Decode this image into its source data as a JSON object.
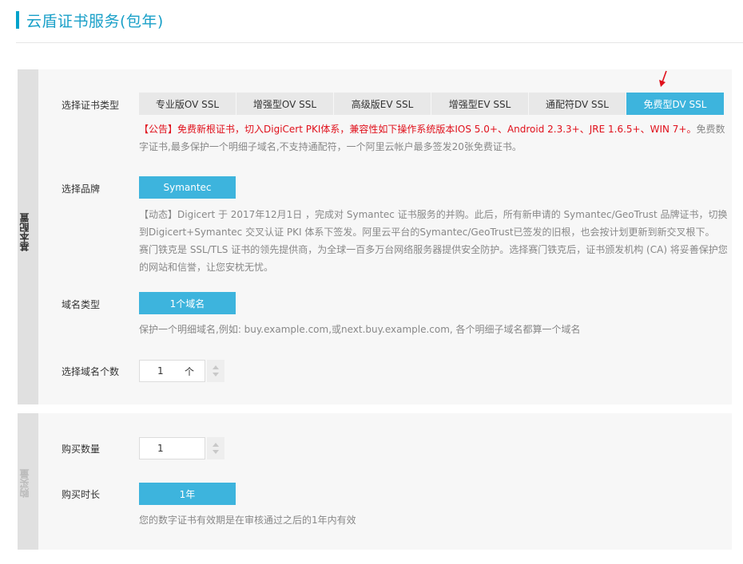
{
  "header": {
    "title": "云盾证书服务(包年)"
  },
  "colors": {
    "accent": "#3db4dd",
    "title": "#1aa0c8",
    "notice_red": "#e0101b",
    "arrow": "#e0101b"
  },
  "section_basic": {
    "side_label": "基本配置",
    "cert_type": {
      "label": "选择证书类型",
      "tabs": [
        "专业版OV SSL",
        "增强型OV SSL",
        "高级版EV SSL",
        "增强型EV SSL",
        "通配符DV SSL",
        "免费型DV SSL"
      ],
      "selected": "免费型DV SSL",
      "notice_red": "【公告】免费新根证书，切入DigiCert PKI体系，兼容性如下操作系统版本IOS 5.0+、Android 2.3.3+、JRE 1.6.5+、WIN 7+。",
      "notice_gray": "免费数字证书,最多保护一个明细子域名,不支持通配符，一个阿里云帐户最多签发20张免费证书。"
    },
    "brand": {
      "label": "选择品牌",
      "button": "Symantec",
      "desc_1": "【动态】Digicert 于 2017年12月1日 ，完成对 Symantec 证书服务的并购。此后，所有新申请的 Symantec/GeoTrust 品牌证书，切换到Digicert+Symantec 交叉认证 PKI 体系下签发。阿里云平台的Symantec/GeoTrust已签发的旧根，也会按计划更新到新交叉根下。",
      "desc_2": "赛门铁克是 SSL/TLS 证书的领先提供商，为全球一百多万台网络服务器提供安全防护。选择赛门铁克后，证书颁发机构 (CA) 将妥善保护您的网站和信誉，让您安枕无忧。"
    },
    "domain_type": {
      "label": "域名类型",
      "button": "1个域名",
      "desc": "保护一个明细域名,例如: buy.example.com,或next.buy.example.com, 各个明细子域名都算一个域名"
    },
    "domain_count": {
      "label": "选择域名个数",
      "value": "1",
      "unit": "个"
    }
  },
  "section_purchase": {
    "side_label": "购买量",
    "quantity": {
      "label": "购买数量",
      "value": "1"
    },
    "duration": {
      "label": "购买时长",
      "button": "1年",
      "desc": "您的数字证书有效期是在审核通过之后的1年内有效"
    }
  }
}
